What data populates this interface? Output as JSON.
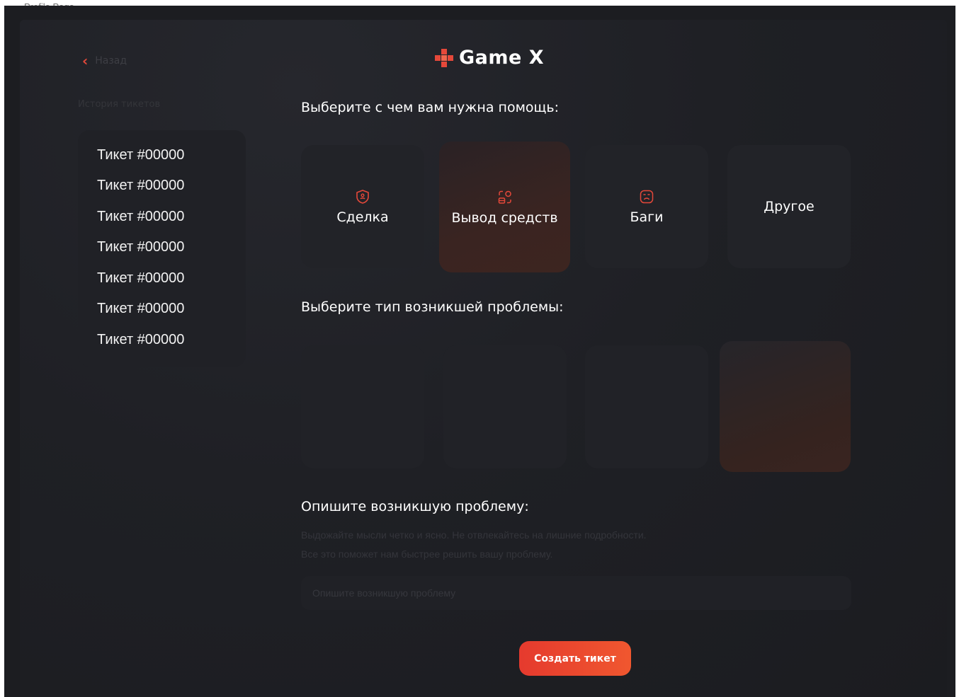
{
  "window": {
    "title": "Profile Page"
  },
  "back": {
    "label": "Назад"
  },
  "history": {
    "title": "История тикетов",
    "tickets": [
      "Тикет #00000",
      "Тикет #00000",
      "Тикет #00000",
      "Тикет #00000",
      "Тикет #00000",
      "Тикет #00000",
      "Тикет #00000"
    ]
  },
  "logo": {
    "text": "Game X",
    "icon": "gamepad-cross-icon",
    "accent": "#e5483a"
  },
  "help": {
    "title": "Выберите с чем вам нужна помощь:",
    "options": [
      {
        "label": "Сделка",
        "icon": "shield-icon"
      },
      {
        "label": "Вывод средств",
        "icon": "withdraw-icon",
        "selected": true
      },
      {
        "label": "Баги",
        "icon": "bug-face-icon"
      },
      {
        "label": "Другое"
      }
    ]
  },
  "problem_type": {
    "title": "Выберите тип возникшей проблемы:",
    "selected_index": 3
  },
  "describe": {
    "title": "Опишите возникшую проблему:",
    "hint_line1": "Выдожайте мысли четко и ясно. Не отвлекайтесь на лишние подробности.",
    "hint_line2": "Все это поможет нам быстрее решить вашу проблему.",
    "placeholder": "Опишите возникшую проблему"
  },
  "submit": {
    "label": "Создать тикет"
  },
  "colors": {
    "accent": "#e5483a",
    "background": "#1c1d21",
    "card": "#222328"
  }
}
